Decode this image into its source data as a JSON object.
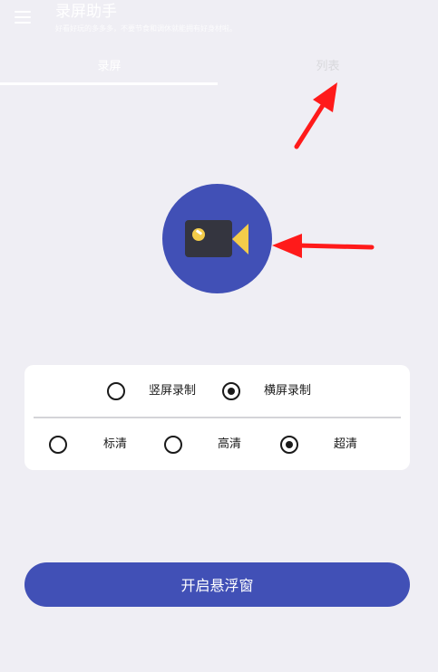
{
  "header": {
    "title": "录屏助手",
    "subtitle": "好看好玩的多多多，不要节食和调休就能拥有好身材啦。"
  },
  "tabs": [
    {
      "label": "录屏",
      "active": true
    },
    {
      "label": "列表",
      "active": false
    }
  ],
  "record_button": {
    "icon": "video-camera-icon"
  },
  "orientation": {
    "options": [
      {
        "label": "竖屏录制",
        "checked": false
      },
      {
        "label": "横屏录制",
        "checked": true
      }
    ]
  },
  "quality": {
    "options": [
      {
        "label": "标清",
        "checked": false
      },
      {
        "label": "高清",
        "checked": false
      },
      {
        "label": "超清",
        "checked": true
      }
    ]
  },
  "start_button": {
    "label": "开启悬浮窗"
  },
  "colors": {
    "primary": "#4150b6",
    "background": "#efeef4",
    "accent": "#f3cc4a",
    "annotation_arrow": "#ff1a1a"
  }
}
